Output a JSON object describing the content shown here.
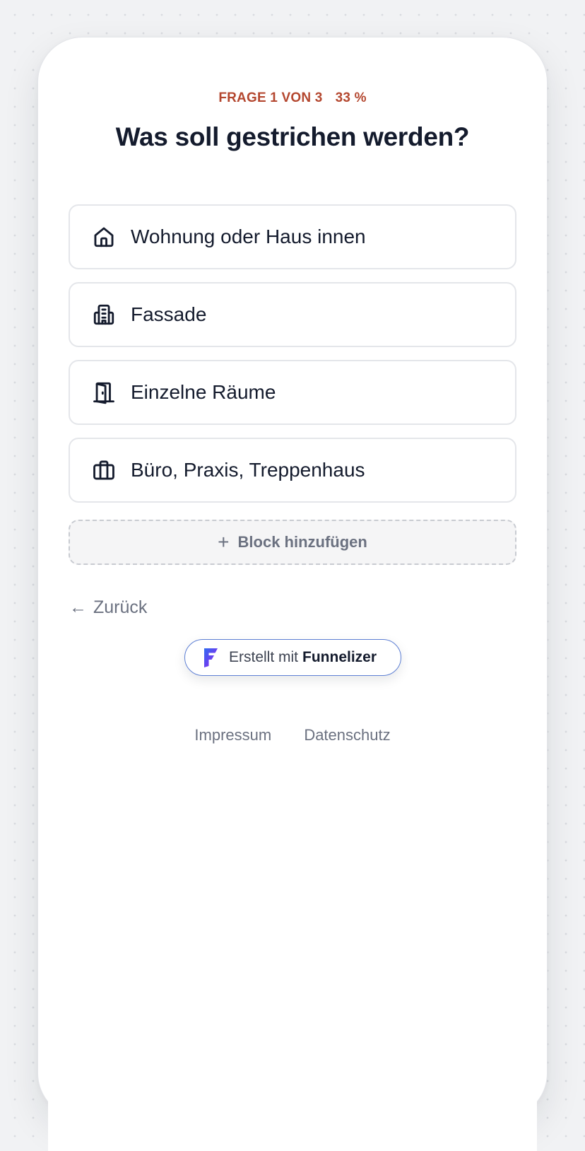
{
  "progress": {
    "label": "FRAGE 1 VON 3",
    "percent_text": "33 %"
  },
  "question": {
    "title": "Was soll gestrichen werden?"
  },
  "options": [
    {
      "label": "Wohnung oder Haus innen",
      "icon": "house-icon"
    },
    {
      "label": "Fassade",
      "icon": "building-icon"
    },
    {
      "label": "Einzelne Räume",
      "icon": "door-icon"
    },
    {
      "label": "Büro, Praxis, Treppenhaus",
      "icon": "briefcase-icon"
    }
  ],
  "add_block": {
    "label": "Block hinzufügen",
    "icon": "plus-icon"
  },
  "navigation": {
    "back_label": "Zurück",
    "back_icon": "arrow-left-icon"
  },
  "badge": {
    "prefix": "Erstellt mit",
    "brand": "Funnelizer",
    "icon": "funnelizer-logo-icon"
  },
  "footer": {
    "links": [
      "Impressum",
      "Datenschutz"
    ]
  },
  "colors": {
    "accent": "#b4472f",
    "text_primary": "#141b2d",
    "text_muted": "#6b7180",
    "badge_border": "#5d7fd4",
    "background": "#f1f2f4"
  }
}
